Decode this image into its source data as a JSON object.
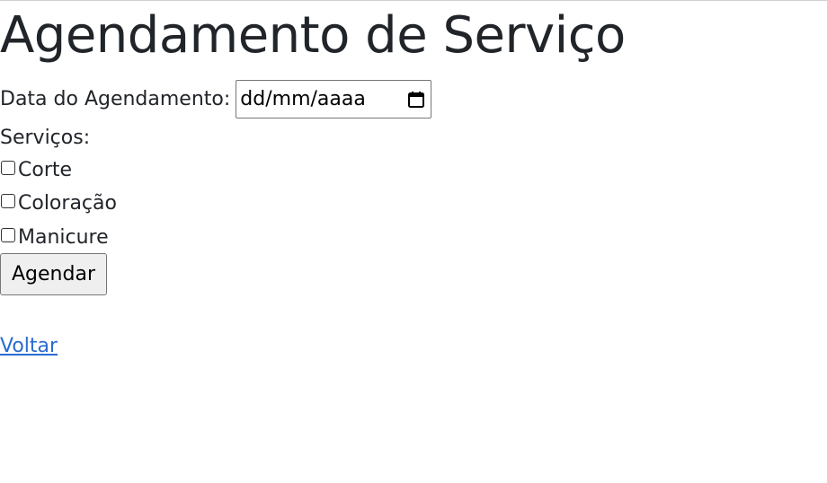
{
  "page": {
    "title": "Agendamento de Serviço"
  },
  "form": {
    "date_label": "Data do Agendamento:",
    "date_placeholder": "dd/mm/aaaa",
    "services_label": "Serviços:",
    "services": [
      {
        "label": "Corte",
        "checked": false
      },
      {
        "label": "Coloração",
        "checked": false
      },
      {
        "label": "Manicure",
        "checked": false
      }
    ],
    "submit_label": "Agendar",
    "calendar_icon": "calendar-icon"
  },
  "nav": {
    "back_label": "Voltar"
  },
  "colors": {
    "text": "#212529",
    "link": "#2a6bd0",
    "button_bg": "#efefef"
  }
}
